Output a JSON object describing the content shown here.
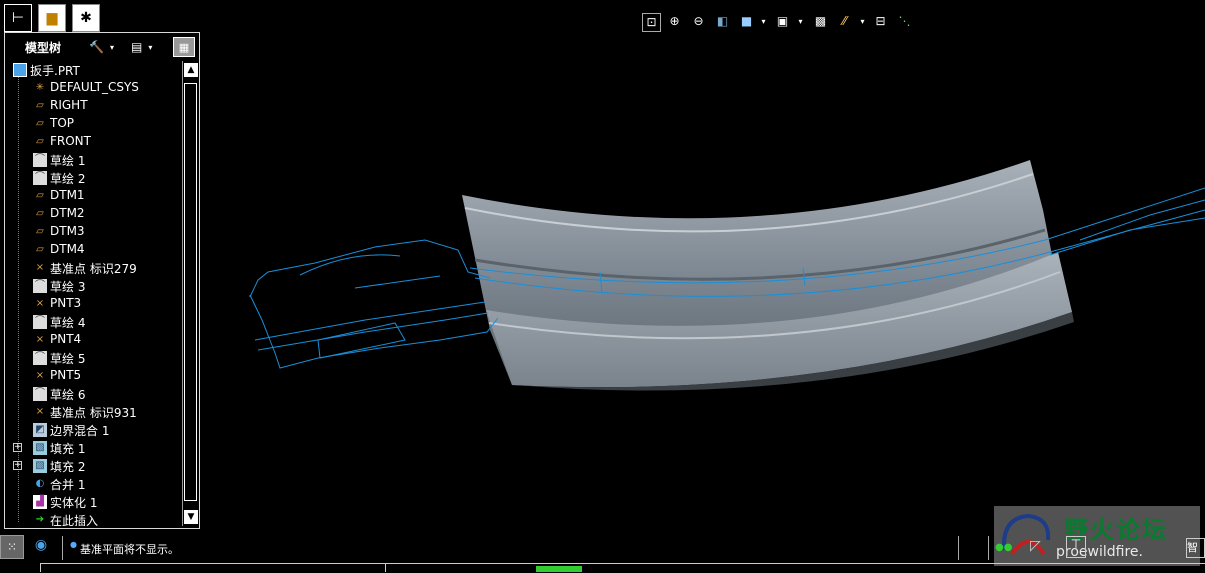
{
  "model_tree": {
    "title": "模型树",
    "items": [
      {
        "label": "扳手.PRT",
        "icon": "part-icon",
        "expandable": false
      },
      {
        "label": "DEFAULT_CSYS",
        "icon": "csys-icon",
        "expandable": false
      },
      {
        "label": "RIGHT",
        "icon": "datum-plane-icon",
        "expandable": false
      },
      {
        "label": "TOP",
        "icon": "datum-plane-icon",
        "expandable": false
      },
      {
        "label": "FRONT",
        "icon": "datum-plane-icon",
        "expandable": false
      },
      {
        "label": "草绘 1",
        "icon": "sketch-icon",
        "expandable": false
      },
      {
        "label": "草绘 2",
        "icon": "sketch-icon",
        "expandable": false
      },
      {
        "label": "DTM1",
        "icon": "datum-plane-icon",
        "expandable": false
      },
      {
        "label": "DTM2",
        "icon": "datum-plane-icon",
        "expandable": false
      },
      {
        "label": "DTM3",
        "icon": "datum-plane-icon",
        "expandable": false
      },
      {
        "label": "DTM4",
        "icon": "datum-plane-icon",
        "expandable": false
      },
      {
        "label": "基准点 标识279",
        "icon": "datum-point-icon",
        "expandable": false
      },
      {
        "label": "草绘 3",
        "icon": "sketch-icon",
        "expandable": false
      },
      {
        "label": "PNT3",
        "icon": "datum-point-icon",
        "expandable": false
      },
      {
        "label": "草绘 4",
        "icon": "sketch-icon",
        "expandable": false
      },
      {
        "label": "PNT4",
        "icon": "datum-point-icon",
        "expandable": false
      },
      {
        "label": "草绘 5",
        "icon": "sketch-icon",
        "expandable": false
      },
      {
        "label": "PNT5",
        "icon": "datum-point-icon",
        "expandable": false
      },
      {
        "label": "草绘 6",
        "icon": "sketch-icon",
        "expandable": false
      },
      {
        "label": "基准点 标识931",
        "icon": "datum-point-icon",
        "expandable": false
      },
      {
        "label": "边界混合 1",
        "icon": "boundary-blend-icon",
        "expandable": false
      },
      {
        "label": "填充 1",
        "icon": "fill-icon",
        "expandable": true
      },
      {
        "label": "填充 2",
        "icon": "fill-icon",
        "expandable": true
      },
      {
        "label": "合并 1",
        "icon": "merge-icon",
        "expandable": false
      },
      {
        "label": "实体化 1",
        "icon": "solidify-icon",
        "expandable": false
      },
      {
        "label": "在此插入",
        "icon": "insert-here-arrow-icon",
        "expandable": false
      }
    ]
  },
  "status": {
    "message": "基准平面将不显示。"
  },
  "watermark": {
    "title": "野火论坛",
    "url": "proewildfire."
  },
  "smart_filter": "智能",
  "colors": {
    "background": "#000000",
    "wireframe": "#1a8fd8",
    "surface": "#8a949e",
    "watermark_green": "#0a7a30"
  }
}
